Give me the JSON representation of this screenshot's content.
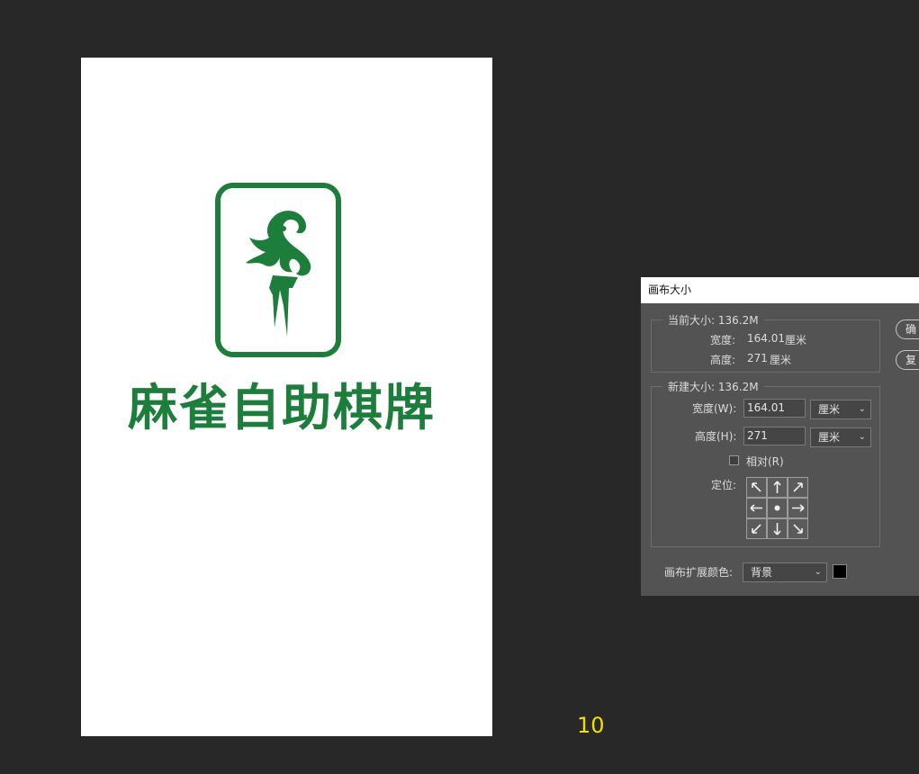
{
  "document": {
    "brand_name": "麻雀自助棋牌",
    "brand_color": "#1d7d3b",
    "page_number": "10"
  },
  "dialog": {
    "title": "画布大小",
    "ok_button": "确",
    "reset_button": "复",
    "current_size": {
      "legend": "当前大小: 136.2M",
      "width_label": "宽度:",
      "width_value": "164.01",
      "width_unit": "厘米",
      "height_label": "高度:",
      "height_value": "271",
      "height_unit": "厘米"
    },
    "new_size": {
      "legend": "新建大小: 136.2M",
      "width_label": "宽度(W):",
      "width_value": "164.01",
      "width_unit": "厘米",
      "height_label": "高度(H):",
      "height_value": "271",
      "height_unit": "厘米",
      "relative_label": "相对(R)",
      "relative_checked": false,
      "anchor_label": "定位:"
    },
    "extension_color": {
      "label": "画布扩展颜色:",
      "value": "背景",
      "swatch_color": "#000000"
    }
  }
}
